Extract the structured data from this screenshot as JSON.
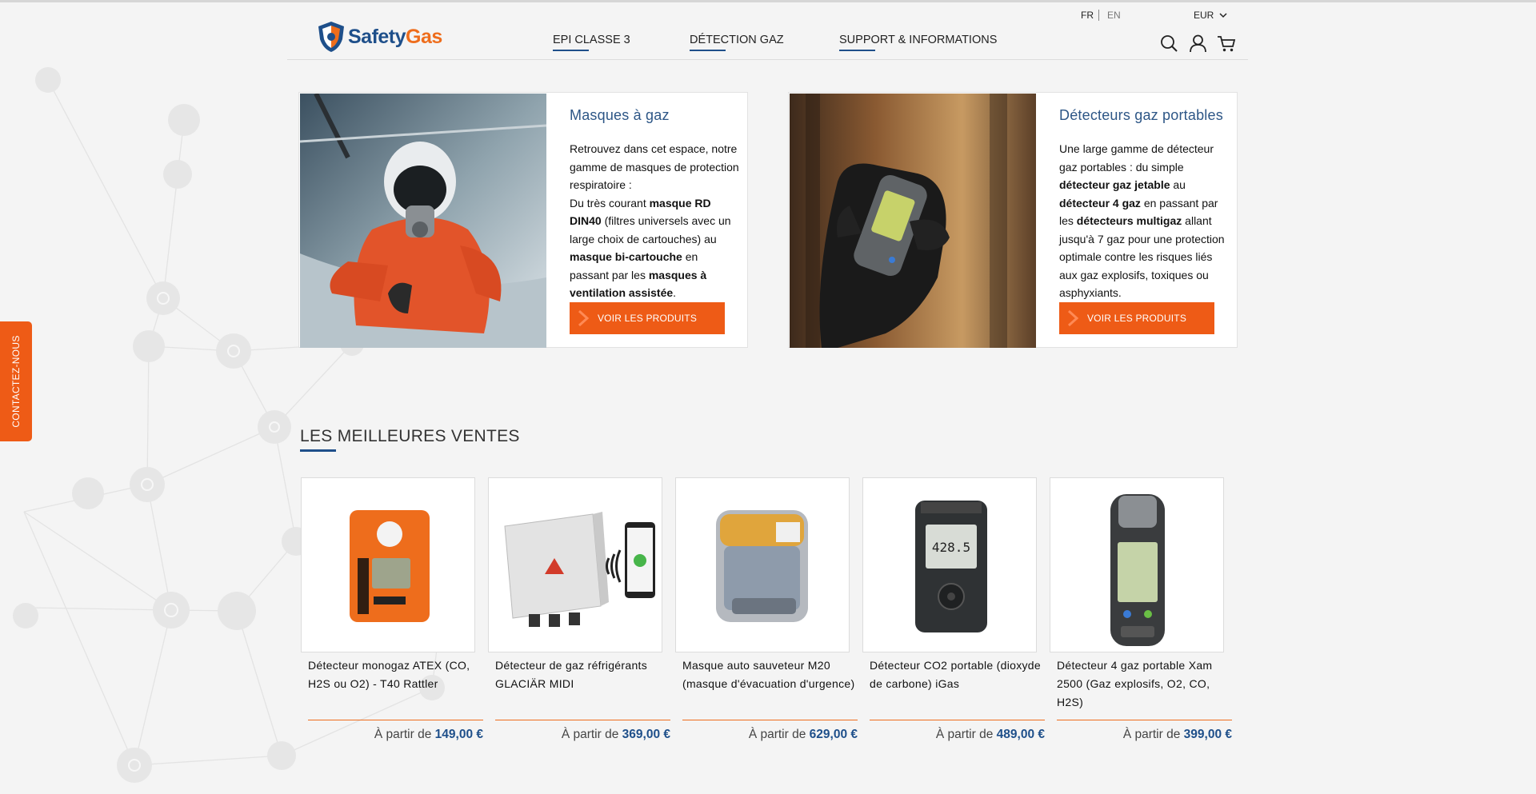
{
  "header": {
    "logo": {
      "part1": "Safety",
      "part2": "Gas"
    },
    "nav": [
      "EPI CLASSE 3",
      "DÉTECTION GAZ",
      "SUPPORT & INFORMATIONS"
    ],
    "lang_fr": "FR",
    "lang_en": "EN",
    "currency": "EUR",
    "icons": [
      "search-icon",
      "user-icon",
      "cart-icon"
    ]
  },
  "contact_tab": "CONTACTEZ-NOUS",
  "categories": [
    {
      "title": "Masques à gaz",
      "text_html": "Retrouvez dans cet espace, notre gamme de masques de protection respiratoire :<br>Du très courant <b>masque RD DIN40</b> (filtres universels avec un large choix de cartouches) au <b>masque bi-cartouche</b> en passant par les <b>masques à ventilation assistée</b>.",
      "button": "VOIR LES PRODUITS"
    },
    {
      "title": "Détecteurs gaz portables",
      "text_html": "Une large gamme de détecteur gaz portables : du simple <b>détecteur gaz jetable</b> au <b>détecteur 4 gaz</b> en passant par les <b>détecteurs multigaz</b> allant jusqu'à 7 gaz pour une protection optimale contre les risques liés aux gaz explosifs, toxiques ou asphyxiants.",
      "button": "VOIR LES PRODUITS"
    }
  ],
  "bestsellers": {
    "title": "LES MEILLEURES VENTES",
    "price_prefix": "À partir de",
    "products": [
      {
        "name": "Détecteur monogaz ATEX (CO, H2S ou O2) - T40 Rattler",
        "price": "149,00 €"
      },
      {
        "name": "Détecteur de gaz réfrigérants GLACIÄR MIDI",
        "price": "369,00 €"
      },
      {
        "name": "Masque auto sauveteur M20 (masque d'évacuation d'urgence)",
        "price": "629,00 €"
      },
      {
        "name": "Détecteur CO2 portable (dioxyde de carbone) iGas",
        "price": "489,00 €"
      },
      {
        "name": "Détecteur 4 gaz portable Xam 2500 (Gaz explosifs, O2, CO, H2S)",
        "price": "399,00 €"
      }
    ],
    "device_screens": {
      "igas": "428.5"
    }
  },
  "colors": {
    "accent": "#ee5b16",
    "brand_blue": "#1e4f8a",
    "title_blue": "#2d5686"
  }
}
